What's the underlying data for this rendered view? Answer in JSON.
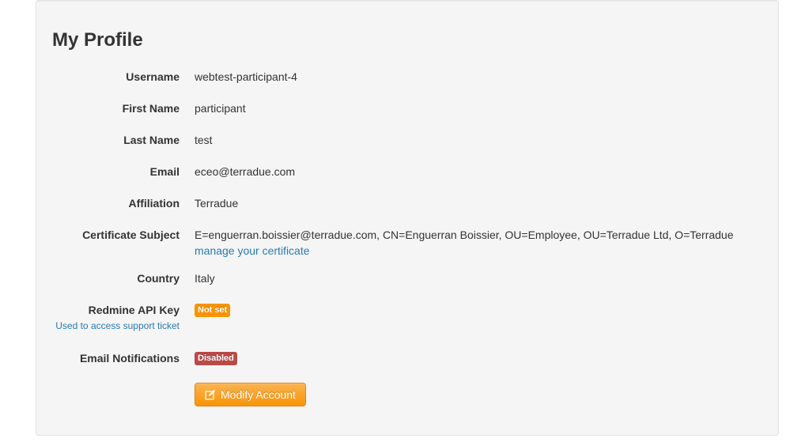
{
  "profile": {
    "title": "My Profile",
    "fields": [
      {
        "label": "Username",
        "value": "webtest-participant-4"
      },
      {
        "label": "First Name",
        "value": "participant"
      },
      {
        "label": "Last Name",
        "value": "test"
      },
      {
        "label": "Email",
        "value": "eceo@terradue.com"
      },
      {
        "label": "Affiliation",
        "value": "Terradue"
      },
      {
        "label": "Certificate Subject",
        "value": "E=enguerran.boissier@terradue.com, CN=Enguerran Boissier, OU=Employee, OU=Terradue Ltd, O=Terradue",
        "link": "manage your certificate"
      },
      {
        "label": "Country",
        "value": "Italy"
      },
      {
        "label": "Redmine API Key",
        "sublabel": "Used to access support ticket",
        "badge": "Not set",
        "badge_color": "#f89406"
      },
      {
        "label": "Email Notifications",
        "badge": "Disabled",
        "badge_color": "#b94a48"
      }
    ],
    "modify_button": {
      "label": "Modify Account",
      "icon": "edit-icon"
    }
  }
}
